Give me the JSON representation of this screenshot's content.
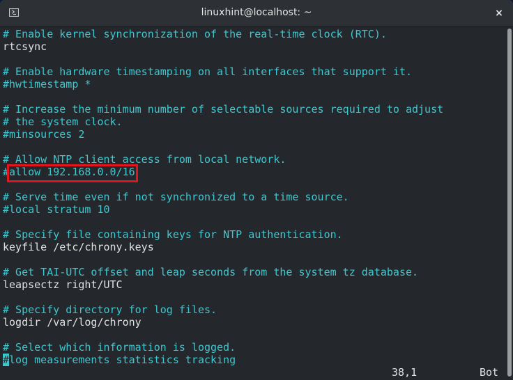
{
  "window": {
    "title": "linuxhint@localhost: ~",
    "close_label": "×"
  },
  "editor": {
    "lines": [
      {
        "text": "# Enable kernel synchronization of the real-time clock (RTC).",
        "type": "comment"
      },
      {
        "text": "rtcsync",
        "type": "directive"
      },
      {
        "text": "",
        "type": "blank"
      },
      {
        "text": "# Enable hardware timestamping on all interfaces that support it.",
        "type": "comment"
      },
      {
        "text": "#hwtimestamp *",
        "type": "comment"
      },
      {
        "text": "",
        "type": "blank"
      },
      {
        "text": "# Increase the minimum number of selectable sources required to adjust",
        "type": "comment"
      },
      {
        "text": "# the system clock.",
        "type": "comment"
      },
      {
        "text": "#minsources 2",
        "type": "comment"
      },
      {
        "text": "",
        "type": "blank"
      },
      {
        "text": "# Allow NTP client access from local network.",
        "type": "comment"
      },
      {
        "text": "#allow 192.168.0.0/16",
        "type": "comment",
        "highlighted": true
      },
      {
        "text": "",
        "type": "blank"
      },
      {
        "text": "# Serve time even if not synchronized to a time source.",
        "type": "comment"
      },
      {
        "text": "#local stratum 10",
        "type": "comment"
      },
      {
        "text": "",
        "type": "blank"
      },
      {
        "text": "# Specify file containing keys for NTP authentication.",
        "type": "comment"
      },
      {
        "text": "keyfile /etc/chrony.keys",
        "type": "directive"
      },
      {
        "text": "",
        "type": "blank"
      },
      {
        "text": "# Get TAI-UTC offset and leap seconds from the system tz database.",
        "type": "comment"
      },
      {
        "text": "leapsectz right/UTC",
        "type": "directive"
      },
      {
        "text": "",
        "type": "blank"
      },
      {
        "text": "# Specify directory for log files.",
        "type": "comment"
      },
      {
        "text": "logdir /var/log/chrony",
        "type": "directive"
      },
      {
        "text": "",
        "type": "blank"
      },
      {
        "text": "# Select which information is logged.",
        "type": "comment"
      },
      {
        "text": "#log measurements statistics tracking",
        "type": "comment",
        "cursor_at": 0
      }
    ],
    "status": {
      "position": "38,1",
      "scroll": "Bot"
    }
  },
  "colors": {
    "comment": "#3fc7cf",
    "text": "#e0e0e0",
    "background": "#24282c",
    "highlight_box": "#e3141b"
  }
}
